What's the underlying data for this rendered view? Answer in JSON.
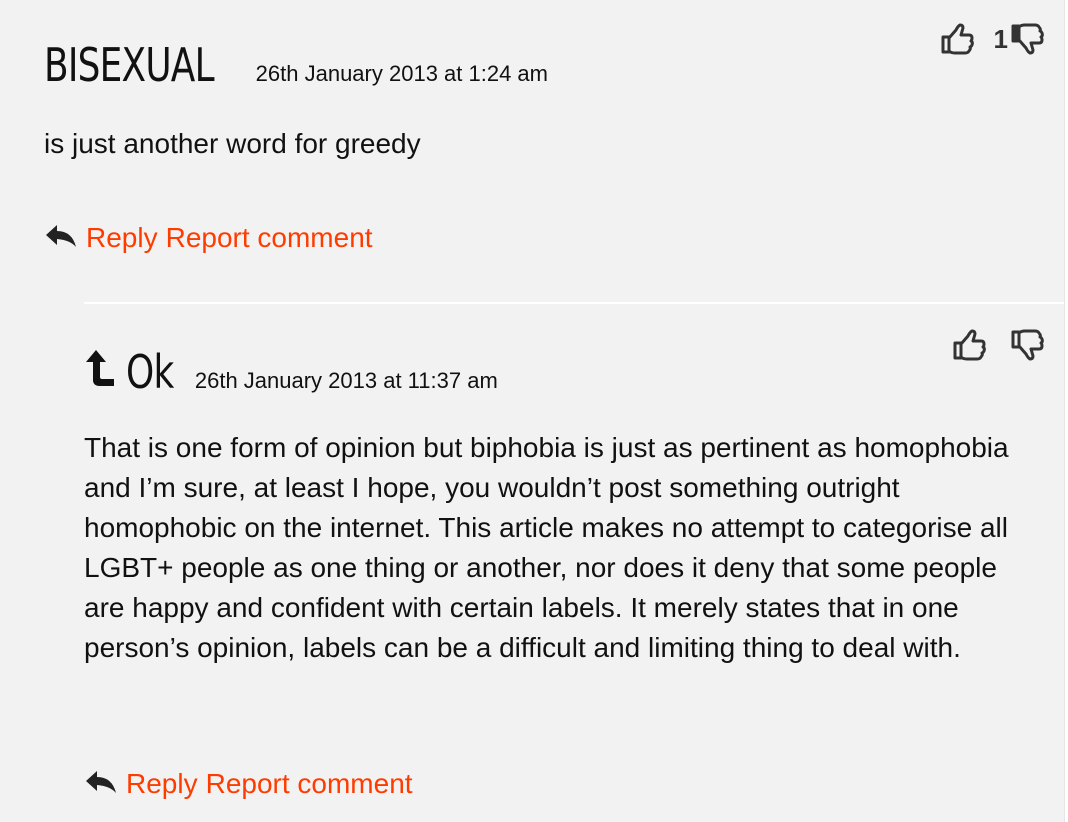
{
  "colors": {
    "link": "#ff3c00",
    "background": "#f2f2f2",
    "text": "#111111"
  },
  "comments": [
    {
      "author": "BISEXUAL",
      "date": "26th January 2013 at 1:24 am",
      "body": "is just another word for greedy",
      "vote_count": "1",
      "reply_label": "Reply",
      "report_label": "Report comment",
      "icons": [
        "thumbs-up-icon",
        "thumbs-down-icon",
        "reply-arrow-icon"
      ]
    },
    {
      "author": "Ok",
      "date": "26th January 2013 at 11:37 am",
      "body": "That is one form of opinion but biphobia is just as pertinent as homophobia and I’m sure, at least I hope, you wouldn’t post something outright homophobic on the internet. This article makes no attempt to categorise all LGBT+ people as one thing or another, nor does it deny that some people are happy and confident with certain labels. It merely states that in one person’s opinion, labels can be a difficult and limiting thing to deal with.",
      "reply_label": "Reply",
      "report_label": "Report comment",
      "icons": [
        "thumbs-up-icon",
        "thumbs-down-icon",
        "in-reply-to-arrow-icon",
        "reply-arrow-icon"
      ]
    }
  ]
}
